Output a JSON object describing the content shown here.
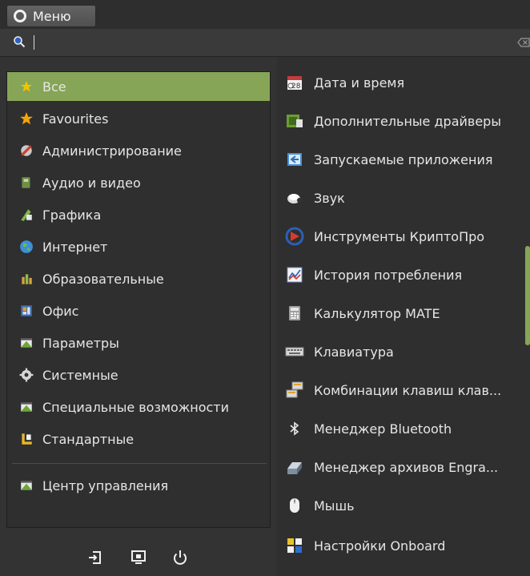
{
  "topbar": {
    "menu_label": "Меню"
  },
  "search": {
    "placeholder": ""
  },
  "categories": [
    {
      "label": "Все",
      "icon": "star-icon",
      "active": true
    },
    {
      "label": "Favourites",
      "icon": "star-icon"
    },
    {
      "label": "Администрирование",
      "icon": "admin-icon"
    },
    {
      "label": "Аудио и видео",
      "icon": "audio-video-icon"
    },
    {
      "label": "Графика",
      "icon": "graphics-icon"
    },
    {
      "label": "Интернет",
      "icon": "globe-icon"
    },
    {
      "label": "Образовательные",
      "icon": "education-icon"
    },
    {
      "label": "Офис",
      "icon": "office-icon"
    },
    {
      "label": "Параметры",
      "icon": "settings-icon"
    },
    {
      "label": "Системные",
      "icon": "system-gear-icon"
    },
    {
      "label": "Специальные возможности",
      "icon": "accessibility-icon"
    },
    {
      "label": "Стандартные",
      "icon": "accessories-icon"
    },
    {
      "label": "Центр управления",
      "icon": "control-center-icon"
    }
  ],
  "apps": [
    {
      "label": "Дата и время",
      "icon": "calendar-icon",
      "icon_text": "28"
    },
    {
      "label": "Дополнительные драйверы",
      "icon": "drivers-icon"
    },
    {
      "label": "Запускаемые приложения",
      "icon": "startup-apps-icon"
    },
    {
      "label": "Звук",
      "icon": "speaker-icon"
    },
    {
      "label": "Инструменты КриптоПро",
      "icon": "cryptopro-icon"
    },
    {
      "label": "История потребления",
      "icon": "usage-history-icon"
    },
    {
      "label": "Калькулятор MATE",
      "icon": "calculator-icon"
    },
    {
      "label": "Клавиатура",
      "icon": "keyboard-icon"
    },
    {
      "label": "Комбинации клавиш клав...",
      "icon": "keyboard-shortcuts-icon"
    },
    {
      "label": "Менеджер Bluetooth",
      "icon": "bluetooth-icon"
    },
    {
      "label": "Менеджер архивов Engra...",
      "icon": "archive-manager-icon"
    },
    {
      "label": "Мышь",
      "icon": "mouse-icon"
    },
    {
      "label": "Настройки Onboard",
      "icon": "onboard-icon"
    }
  ],
  "footer": {
    "buttons": [
      "logout-icon",
      "lock-screen-icon",
      "power-icon"
    ]
  },
  "colors": {
    "accent": "#87a556",
    "bg": "#333333",
    "text": "#e6e6e6"
  }
}
